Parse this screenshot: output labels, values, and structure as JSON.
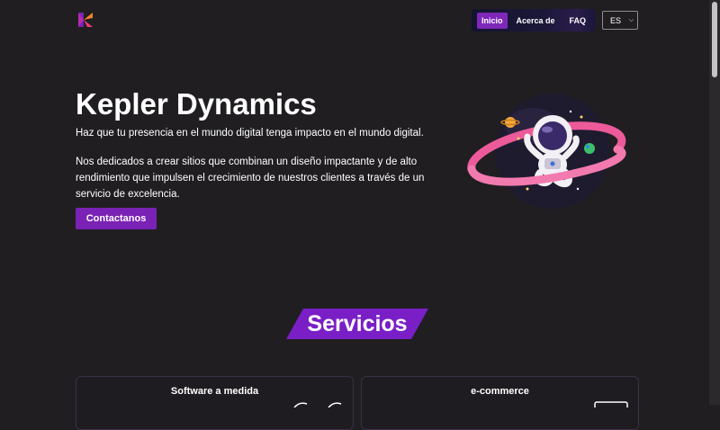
{
  "header": {
    "logo_icon": "kepler-k-logo",
    "nav": [
      {
        "label": "Inicio",
        "active": true
      },
      {
        "label": "Acerca de",
        "active": false
      },
      {
        "label": "FAQ",
        "active": false
      }
    ],
    "language": {
      "selected": "ES",
      "icon": "chevron-down-icon"
    }
  },
  "hero": {
    "title": "Kepler Dynamics",
    "tagline": "Haz que tu presencia en el mundo digital tenga impacto en el mundo digital.",
    "description": "Nos dedicados a crear sitios que combinan un diseño impactante y de alto rendimiento que impulsen el crecimiento de nuestros clientes a través de un servicio de excelencia.",
    "cta_label": "Contactanos",
    "illustration": "astronaut-planet-illustration"
  },
  "services": {
    "title": "Servicios",
    "cards": [
      {
        "title": "Software a medida"
      },
      {
        "title": "e-commerce"
      }
    ]
  },
  "colors": {
    "background": "#201e21",
    "accent": "#7a22b5",
    "nav_bg": "#16152f",
    "planet_ring": "#ec5a9a"
  }
}
